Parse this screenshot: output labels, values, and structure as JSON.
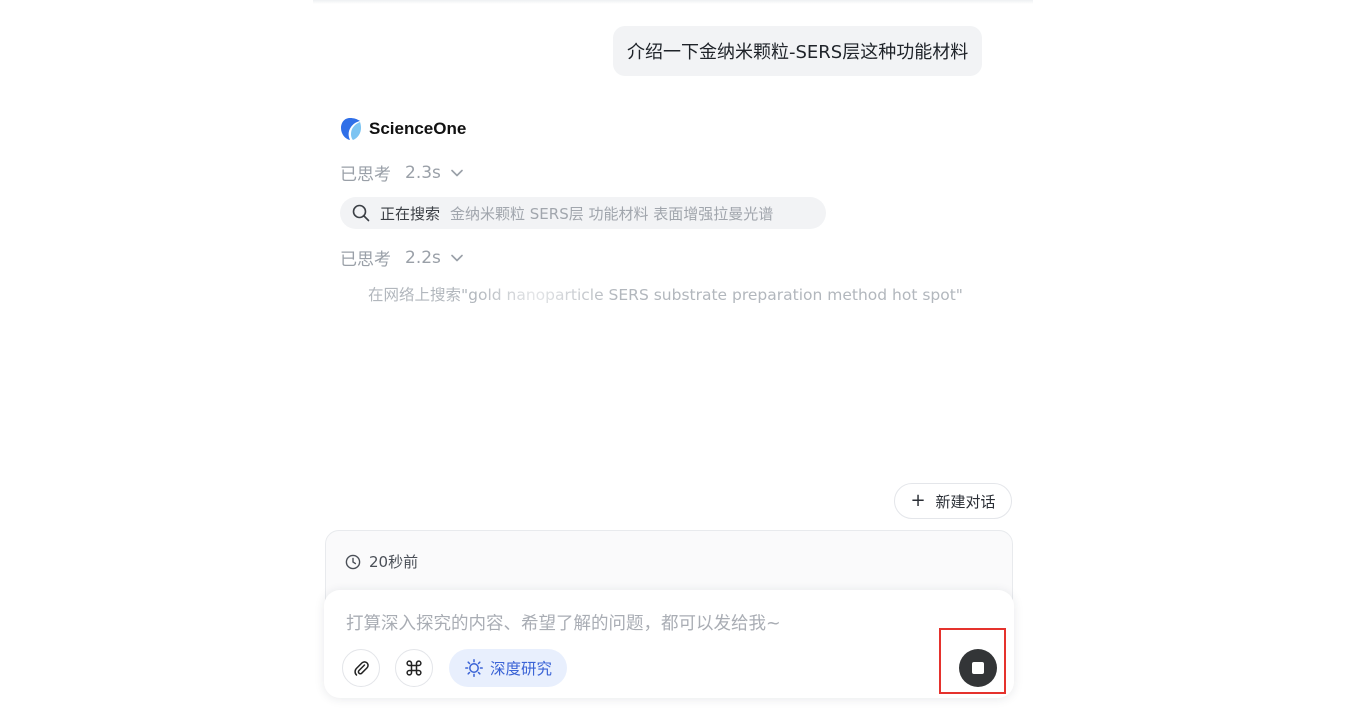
{
  "conversation": {
    "user_message": "介绍一下金纳米颗粒-SERS层这种功能材料"
  },
  "assistant": {
    "brand_name": "ScienceOne",
    "thoughts": [
      {
        "label": "已思考",
        "duration": "2.3s"
      },
      {
        "label": "已思考",
        "duration": "2.2s"
      }
    ],
    "search_status": {
      "label": "正在搜索",
      "query": "金纳米颗粒 SERS层 功能材料 表面增强拉曼光谱"
    },
    "web_search_text": "在网络上搜索\"gold nanoparticle SERS substrate preparation method hot spot\""
  },
  "new_chat": {
    "label": "新建对话"
  },
  "history": {
    "time_label": "20秒前"
  },
  "composer": {
    "placeholder": "打算深入探究的内容、希望了解的问题，都可以发给我~",
    "deep_research_label": "深度研究"
  },
  "icons": {
    "attach": "paperclip-icon",
    "command": "command-icon",
    "deep_research": "sparkle-icon",
    "stop": "stop-icon",
    "clock": "clock-icon",
    "search": "search-icon"
  },
  "colors": {
    "accent_blue": "#3a63d6",
    "highlight_red": "#e5322d",
    "stop_button": "#333537"
  }
}
